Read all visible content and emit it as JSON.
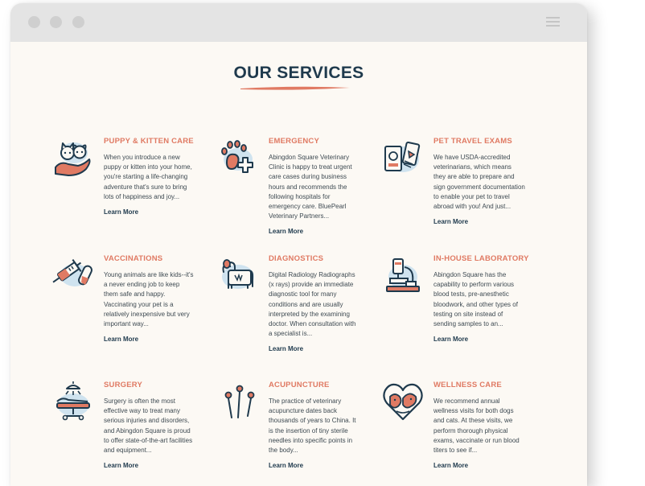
{
  "section": {
    "title": "OUR SERVICES"
  },
  "services": [
    {
      "id": "puppy-kitten-care",
      "title": "PUPPY & KITTEN CARE",
      "icon": "pet-in-hand-icon",
      "text": "When you introduce a new puppy or kitten into your home, you're starting a life-changing adventure that's sure to bring lots of happiness and joy...",
      "link": "Learn More"
    },
    {
      "id": "emergency",
      "title": "EMERGENCY",
      "icon": "paw-plus-icon",
      "text": "Abingdon Square Veterinary Clinic is happy to treat urgent care cases during business hours and recommends the following hospitals for emergency care. BluePearl Veterinary Partners...",
      "link": "Learn More"
    },
    {
      "id": "pet-travel-exams",
      "title": "PET TRAVEL EXAMS",
      "icon": "passport-ticket-icon",
      "text": "We have USDA-accredited veterinarians, which means they are able to prepare and sign government documentation to enable your pet to travel abroad with you! And just...",
      "link": "Learn More"
    },
    {
      "id": "vaccinations",
      "title": "VACCINATIONS",
      "icon": "syringe-pill-icon",
      "text": "Young animals are like kids--it's a never ending job to keep them safe and happy. Vaccinating your pet is a relatively inexpensive but very important way...",
      "link": "Learn More"
    },
    {
      "id": "diagnostics",
      "title": "DIAGNOSTICS",
      "icon": "dog-xray-icon",
      "text": "Digital Radiology Radiographs (x rays) provide an immediate diagnostic tool for many conditions and are usually interpreted by the examining doctor. When consultation with a specialist is...",
      "link": "Learn More"
    },
    {
      "id": "in-house-laboratory",
      "title": "IN-HOUSE LABORATORY",
      "icon": "microscope-icon",
      "text": "Abingdon Square has the capability to perform various blood tests, pre-anesthetic bloodwork, and other types of testing on site instead of sending samples to an...",
      "link": "Learn More"
    },
    {
      "id": "surgery",
      "title": "SURGERY",
      "icon": "surgery-table-icon",
      "text": "Surgery is often the most effective way to treat many serious injuries and disorders, and Abingdon Square is proud to offer state-of-the-art facilities and equipment...",
      "link": "Learn More"
    },
    {
      "id": "acupuncture",
      "title": "ACUPUNCTURE",
      "icon": "needles-icon",
      "text": "The practice of veterinary acupuncture dates back thousands of years to China. It is the insertion of tiny sterile needles into specific points in the body...",
      "link": "Learn More"
    },
    {
      "id": "wellness-care",
      "title": "WELLNESS CARE",
      "icon": "pets-heart-icon",
      "text": "We recommend annual wellness visits for both dogs and cats. At these visits, we perform thorough physical exams, vaccinate or run blood titers to see if...",
      "link": "Learn More"
    }
  ],
  "colors": {
    "accent": "#e07a63",
    "navy": "#1f3a4d",
    "background": "#fcf9f4",
    "titlebar": "#e4e4e4",
    "highlight": "#cfe3ef"
  }
}
